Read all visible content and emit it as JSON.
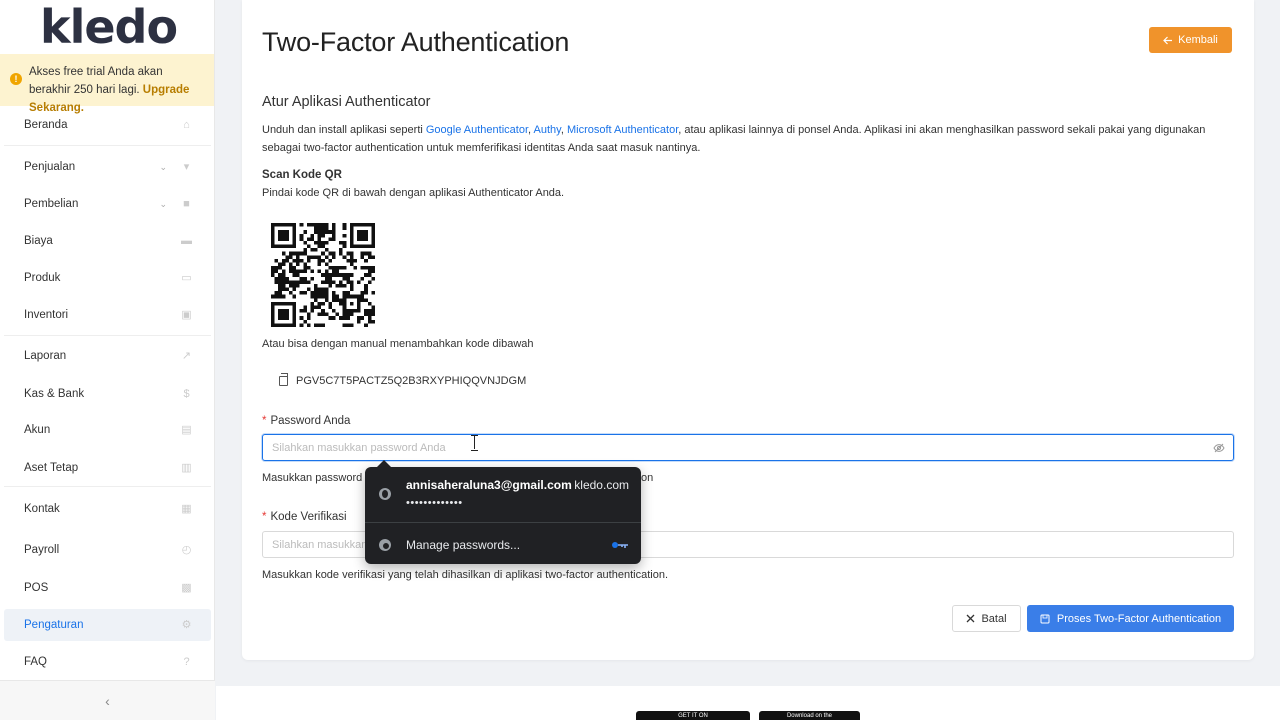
{
  "brand": {
    "logo_text": "kledo"
  },
  "trial": {
    "text": "Akses free trial Anda akan berakhir 250 hari lagi.",
    "link": "Upgrade Sekarang."
  },
  "sidebar": {
    "items": [
      {
        "label": "Beranda",
        "icon": "home-icon"
      },
      {
        "label": "Penjualan",
        "icon": "basket-icon",
        "expandable": true
      },
      {
        "label": "Pembelian",
        "icon": "bag-icon",
        "expandable": true
      },
      {
        "label": "Biaya",
        "icon": "card-icon"
      },
      {
        "label": "Produk",
        "icon": "box-icon"
      },
      {
        "label": "Inventori",
        "icon": "inventory-icon"
      },
      {
        "label": "Laporan",
        "icon": "chart-icon"
      },
      {
        "label": "Kas & Bank",
        "icon": "dollar-icon"
      },
      {
        "label": "Akun",
        "icon": "account-icon"
      },
      {
        "label": "Aset Tetap",
        "icon": "building-icon"
      },
      {
        "label": "Kontak",
        "icon": "contact-icon"
      },
      {
        "label": "Payroll",
        "icon": "payroll-icon"
      },
      {
        "label": "POS",
        "icon": "pos-icon"
      },
      {
        "label": "Pengaturan",
        "icon": "settings-icon",
        "active": true
      },
      {
        "label": "FAQ",
        "icon": "question-icon"
      }
    ],
    "collapse_glyph": "‹"
  },
  "page": {
    "title": "Two-Factor Authentication",
    "back_label": "Kembali",
    "section_title": "Atur Aplikasi Authenticator",
    "desc": {
      "before": "Unduh dan install aplikasi seperti ",
      "link1": "Google Authenticator",
      "sep1": ", ",
      "link2": "Authy",
      "sep2": ", ",
      "link3": "Microsoft Authenticator",
      "after": ", atau aplikasi lainnya di ponsel Anda. Aplikasi ini akan menghasilkan password sekali pakai yang digunakan sebagai two-factor authentication untuk memferifikasi identitas Anda saat masuk nantinya."
    },
    "scan_title": "Scan Kode QR",
    "scan_desc": "Pindai kode QR di bawah dengan aplikasi Authenticator Anda.",
    "manual_text": "Atau bisa dengan manual menambahkan kode dibawah",
    "secret_code": "PGV5C7T5PACTZ5Q2B3RXYPHIQQVNJDGM",
    "password": {
      "required_mark": "*",
      "label": "Password Anda",
      "placeholder": "Silahkan masukkan password Anda",
      "help_start": "Masukkan password ",
      "help_end": "on"
    },
    "verification": {
      "required_mark": "*",
      "label": "Kode Verifikasi",
      "placeholder": "Silahkan masukkan",
      "help": "Masukkan kode verifikasi yang telah dihasilkan di aplikasi two-factor authentication."
    },
    "cancel_label": "Batal",
    "submit_label": "Proses Two-Factor Authentication"
  },
  "password_popup": {
    "email": "annisaheraluna3@gmail.com",
    "site": "kledo.com",
    "masked_password": "•••••••••••••",
    "manage_label": "Manage passwords..."
  },
  "footer": {
    "store1": "GET IT ON",
    "store2": "Download on the"
  },
  "colors": {
    "accent": "#1a73e8",
    "back_button": "#f0932b",
    "submit_button": "#3a7ee8",
    "trial_bg": "#fdf3d0",
    "popup_bg": "#202124"
  }
}
